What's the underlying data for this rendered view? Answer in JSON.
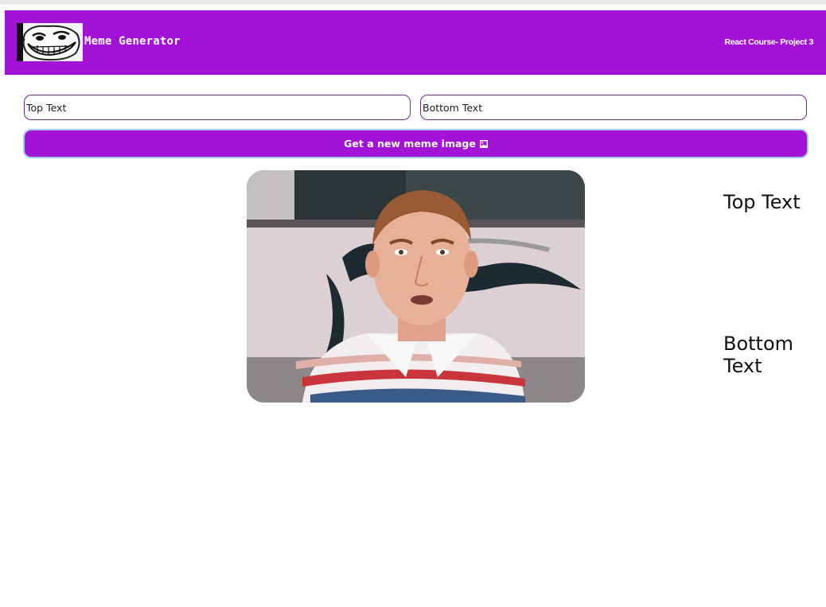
{
  "header": {
    "title": "Meme Generator",
    "course_label": "React Course- Project 3",
    "logo_icon": "troll-face-icon"
  },
  "form": {
    "top_text": {
      "value": "Top Text",
      "placeholder": "Top Text"
    },
    "bottom_text": {
      "value": "Bottom Text",
      "placeholder": "Bottom Text"
    },
    "button_label": "Get a new meme image",
    "button_icon": "picture-icon"
  },
  "meme": {
    "top_text": "Top Text",
    "bottom_text": "Bottom Text"
  },
  "colors": {
    "brand": "#a313d6",
    "input_border": "#6b2b84",
    "button_focus_ring": "#a8c8f4"
  }
}
